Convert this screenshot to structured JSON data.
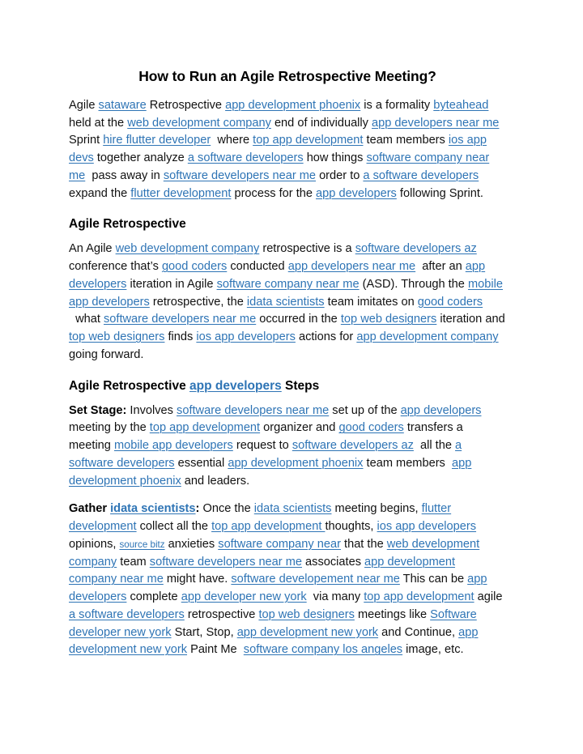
{
  "document": {
    "title": "How to Run an Agile Retrospective Meeting?",
    "link_color": "#2E74B5",
    "text_color": "#111111",
    "background": "#ffffff"
  },
  "paragraphs": {
    "intro": {
      "t1": "Agile ",
      "l1": "sataware",
      "t2": " Retrospective ",
      "l2": "app development phoenix",
      "t3": " is a formality ",
      "l3": "byteahead",
      "t4": " held at the ",
      "l4": "web development company",
      "t5": " end of individually ",
      "l5": "app developers near me",
      "t6": " Sprint ",
      "l6": "hire flutter developer",
      "t7": "  where ",
      "l7": "top app development",
      "t8": " team members ",
      "l8": "ios app devs",
      "t9": " together analyze ",
      "l9": "a software developers",
      "t10": " how things ",
      "l10": "software company near me",
      "t11": "  pass away in ",
      "l11": "software developers near me",
      "t12": " order to ",
      "l12": "a software developers",
      "t13": " expand the ",
      "l13": "flutter development",
      "t14": " process for the ",
      "l14": "app developers",
      "t15": " following Sprint."
    },
    "heading1": "Agile Retrospective",
    "retro": {
      "t1": "An Agile ",
      "l1": "web development company",
      "t2": " retrospective is a ",
      "l2": "software developers az",
      "t3": " conference that’s ",
      "l3": "good coders",
      "t4": " conducted ",
      "l4": "app developers near me",
      "t5": "  after an ",
      "l5": "app developers",
      "t6": " iteration in Agile ",
      "l6": "software company near me",
      "t7": " (ASD). Through the ",
      "l7": "mobile app developers",
      "t8": " retrospective, the ",
      "l8": "idata scientists",
      "t9": " team imitates on ",
      "l9": "good coders",
      "t10": "  what ",
      "l10": "software developers near me",
      "t11": " occurred in the ",
      "l11": "top web designers",
      "t12": " iteration and ",
      "l12": "top web designers",
      "t13": " finds ",
      "l13": "ios app developers",
      "t14": " actions for ",
      "l14": "app development company",
      "t15": " going forward."
    },
    "heading2": {
      "pre": "Agile Retrospective ",
      "link": "app developers",
      "post": " Steps"
    },
    "set_stage": {
      "lead": "Set Stage:",
      "t1": " Involves ",
      "l1": "software developers near me",
      "t2": " set up of the ",
      "l2": "app developers",
      "t3": " meeting by the ",
      "l3": "top app development",
      "t4": " organizer and ",
      "l4": "good coders",
      "t5": " transfers a meeting ",
      "l5": "mobile app developers",
      "t6": " request to ",
      "l6": "software developers az",
      "t7": "  all the ",
      "l7": "a software developers",
      "t8": " essential ",
      "l8": "app development phoenix",
      "t9": " team members  ",
      "l9": "app development phoenix",
      "t10": " and leaders."
    },
    "gather": {
      "lead_pre": "Gather ",
      "lead_link": "idata scientists",
      "lead_post": ":",
      "t1": " Once the ",
      "l1": "idata scientists",
      "t2": " meeting begins, ",
      "l2": "flutter development",
      "t3": " collect all the ",
      "l3": "top app development ",
      "t4": " thoughts, ",
      "l4": "ios app developers",
      "t5": " opinions, ",
      "l5": "source bitz",
      "t6": " anxieties ",
      "l6": "software company near",
      "t7": " that the ",
      "l7": "web development company",
      "t8": " team ",
      "l8": "software developers near me",
      "t9": " associates ",
      "l9": "app development company near me",
      "t10": " might have. ",
      "l10": "software developement near me",
      "t11": " This can be ",
      "l11": "app developers",
      "t12": " complete ",
      "l12": "app developer new york",
      "t13": "  via many ",
      "l13": "top app development",
      "t14": " agile ",
      "l14": "a software developers",
      "t15": " retrospective ",
      "l15": "top web designers",
      "t16": " meetings like ",
      "l16": "Software developer new york",
      "t17": " Start, Stop, ",
      "l17": "app development new york",
      "t18": " and Continue, ",
      "l18": "app development new york",
      "t19": " Paint Me  ",
      "l19": "software company los angeles",
      "t20": " image, etc."
    }
  }
}
